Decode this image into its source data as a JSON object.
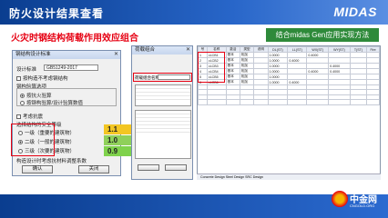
{
  "header": {
    "title": "防火设计结果查看",
    "logo": "MIDAS"
  },
  "subtitle": "火灾时钢结构荷载作用效应组合",
  "tag": "结合midas Gen应用实现方法",
  "dialog1": {
    "title": "钢结构设计标准",
    "std_label": "设计标准",
    "std_value": "GB51249-2017",
    "chk1": "按构造不考虑钢结构",
    "group_title": "钢构验算选项",
    "opt1": "按抗火验算",
    "opt2": "按钢构验算/设计验算数值",
    "chk2": "考虑抗震",
    "level_title": "选择结构的安全等级",
    "levels": [
      "一级（重要的建筑物）",
      "二级（一般的建筑物）",
      "三级（次要的建筑物）"
    ],
    "factors": [
      "1.1",
      "1.0",
      "0.9"
    ],
    "note": "构造设计时考虑抗材料调整系数",
    "ok": "确认",
    "close": "关闭"
  },
  "dialog2": {
    "title": "荷载组合",
    "field": "荷载组合名称"
  },
  "table": {
    "headers": [
      "号",
      "名称",
      "激活",
      "类型",
      "说明",
      "DL(ST)",
      "LL(ST)",
      "WX(ST)",
      "WY(ST)",
      "T(ST)",
      "Fire"
    ],
    "rows": [
      [
        "1",
        "cLCB1",
        "基本",
        "相加",
        "",
        "1.0000",
        "",
        "0.4000",
        "",
        "",
        ""
      ],
      [
        "2",
        "cLCB2",
        "基本",
        "相加",
        "",
        "1.0000",
        "0.4000",
        "",
        "",
        "",
        ""
      ],
      [
        "3",
        "cLCB3",
        "基本",
        "相加",
        "",
        "1.0000",
        "",
        "",
        "0.4000",
        "",
        ""
      ],
      [
        "4",
        "cLCB4",
        "基本",
        "相加",
        "",
        "1.0000",
        "",
        "0.4000",
        "0.4000",
        "",
        ""
      ],
      [
        "5",
        "cLCB5",
        "基本",
        "相加",
        "",
        "1.0000",
        "",
        "",
        "",
        "",
        ""
      ],
      [
        "6",
        "cLCB6",
        "基本",
        "相加",
        "",
        "1.0000",
        "0.4000",
        "",
        "",
        "",
        ""
      ]
    ],
    "tabs": "Concrete Design  Steel Design  SRC Design"
  },
  "brand": {
    "name": "中金网",
    "en": "CNGOLD.ORG"
  }
}
